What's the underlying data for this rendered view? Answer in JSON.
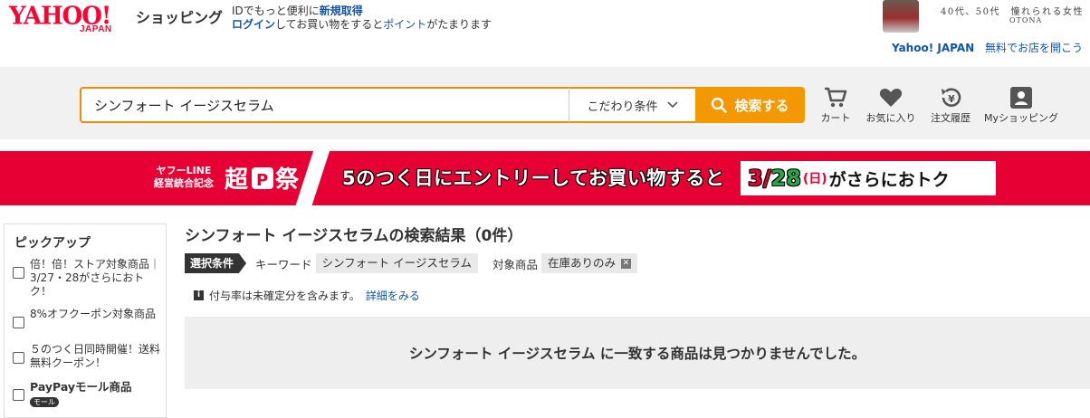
{
  "header": {
    "logo_text": "YAHOO!",
    "logo_sub": "JAPAN",
    "shop_label": "ショッピング",
    "login_prefix": "IDでもっと便利に",
    "signup_link": "新規取得",
    "login_link": "ログイン",
    "login_mid": "してお買い物をすると",
    "points_link": "ポイント",
    "login_suffix": "がたまります",
    "ad_line1": "40代、50代　憧れられる女性",
    "ad_line2": "OTONA",
    "ad_link1": "Yahoo! JAPAN",
    "ad_link2": "無料でお店を開こう"
  },
  "search": {
    "query": "シンフォート イージスセラム",
    "condition_label": "こだわり条件",
    "button_label": "検索する"
  },
  "nav": {
    "cart": "カート",
    "favorites": "お気に入り",
    "orders": "注文履歴",
    "my_shopping": "Myショッピング"
  },
  "banner": {
    "left_line1": "ヤフーLINE",
    "left_line2": "経営統合記念",
    "fest": "超PayPay祭",
    "main_text": "5のつく日にエントリーしてお買い物すると",
    "date_month": "3/",
    "date_day": "28",
    "date_weekday": "(日)",
    "date_rest": "がさらにおトク"
  },
  "sidebar": {
    "title": "ピックアップ",
    "items": [
      {
        "label": "倍！倍！ストア対象商品｜3/27・28がさらにおトク！"
      },
      {
        "label": "8%オフクーポン対象商品"
      },
      {
        "label": "５のつく日同時開催！送料無料クーポン！"
      },
      {
        "label": "PayPayモール商品",
        "badge": "モール"
      }
    ]
  },
  "results": {
    "title": "シンフォート イージスセラムの検索結果（0件）",
    "selected_label": "選択条件",
    "keyword_label": "キーワード",
    "keyword_value": "シンフォート イージスセラム",
    "target_label": "対象商品",
    "target_value": "在庫ありのみ",
    "note_text": "付与率は未確定分を含みます。",
    "note_link": "詳細をみる",
    "empty_message": "シンフォート イージスセラム に一致する商品は見つかりませんでした。"
  },
  "colors": {
    "brand_red": "#ff0033",
    "banner_red": "#e60033",
    "search_orange": "#f39800",
    "link_blue": "#1155aa"
  }
}
